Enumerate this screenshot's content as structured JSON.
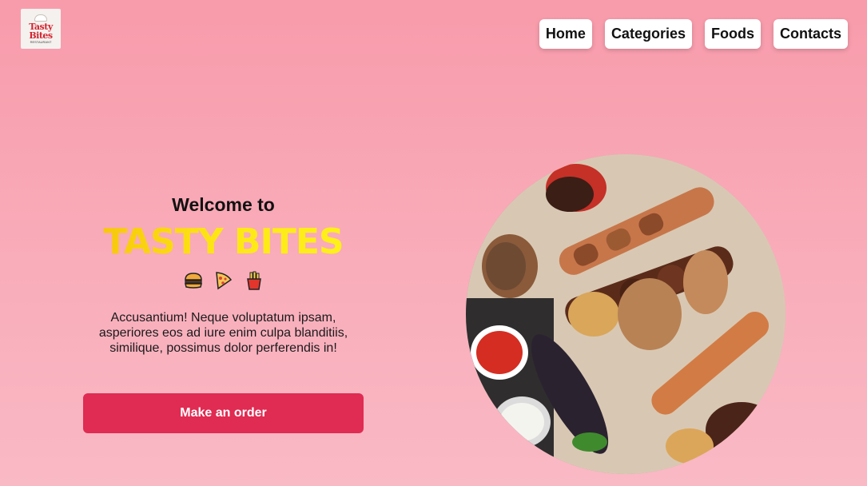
{
  "logo": {
    "line1": "Tasty",
    "line2": "Bites",
    "line3": "RESTAURANT"
  },
  "nav": {
    "items": [
      "Home",
      "Categories",
      "Foods",
      "Contacts"
    ]
  },
  "hero": {
    "welcome": "Welcome to",
    "brand": "TASTY BITES",
    "icons": [
      "burger-icon",
      "pizza-icon",
      "fries-icon"
    ],
    "tagline": "Accusantium! Neque voluptatum ipsam, asperiores eos ad iure enim culpa blanditiis, similique, possimus dolor perferendis in!",
    "cta": "Make an order"
  },
  "colors": {
    "accent": "#e02b52",
    "brand_yellow": "#fde716",
    "background": "#f9a8b6"
  }
}
